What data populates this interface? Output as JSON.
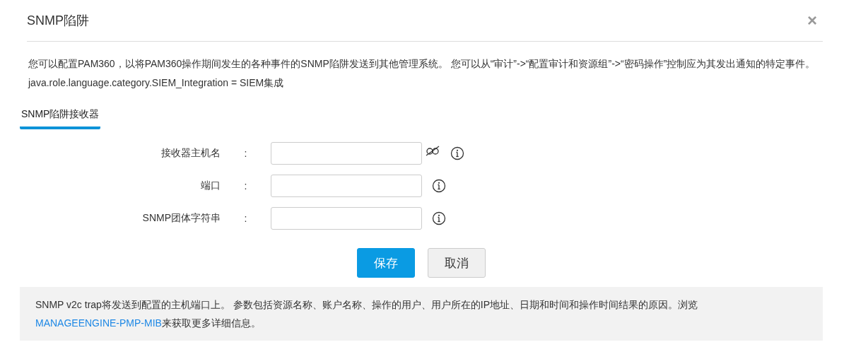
{
  "dialog": {
    "title": "SNMP陷阱",
    "close": "×"
  },
  "description": "您可以配置PAM360，以将PAM360操作期间发生的各种事件的SNMP陷阱发送到其他管理系统。 您可以从“审计”->“配置审计和资源组”->“密码操作”控制应为其发出通知的特定事件。 java.role.language.category.SIEM_Integration = SIEM集成",
  "tabs": [
    {
      "label": "SNMP陷阱接收器",
      "selected": true
    }
  ],
  "fields": [
    {
      "label": "接收器主机名",
      "colon": ":",
      "reveal_toggle": true
    },
    {
      "label": "端口",
      "colon": ":",
      "reveal_toggle": false
    },
    {
      "label": "SNMP团体字符串",
      "colon": ":",
      "reveal_toggle": false
    }
  ],
  "buttons": [
    {
      "label": "保存",
      "kind": "primary"
    },
    {
      "label": "取消",
      "kind": "secondary"
    }
  ],
  "note": {
    "text_before": "SNMP v2c trap将发送到配置的主机端口上。 参数包括资源名称、账户名称、操作的用户、用户所在的IP地址、日期和时间和操作时间结果的原因。浏览",
    "link": "MANAGEENGINE-PMP-MIB",
    "text_after": "来获取更多详细信息。"
  }
}
